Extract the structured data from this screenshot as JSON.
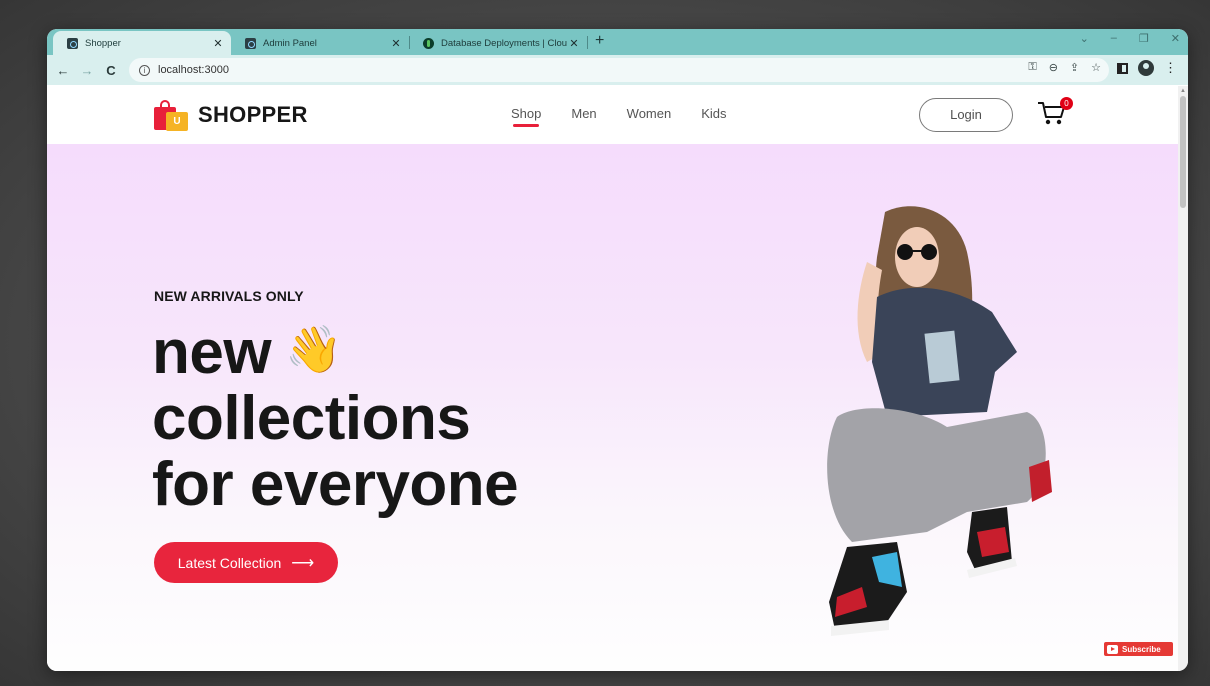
{
  "browser": {
    "tabs": [
      {
        "title": "Shopper",
        "active": true
      },
      {
        "title": "Admin Panel",
        "active": false
      },
      {
        "title": "Database Deployments | Cloud: M",
        "active": false
      }
    ],
    "new_tab": "+",
    "address": "localhost:3000",
    "nav": {
      "back": "←",
      "forward": "→",
      "reload": "C"
    },
    "window_controls": {
      "minimize": "–",
      "maximize": "❐",
      "close": "✕",
      "tabs_dropdown": "⌄"
    }
  },
  "site": {
    "brand": "SHOPPER",
    "logo_letter": "U",
    "menu": [
      {
        "label": "Shop",
        "active": true
      },
      {
        "label": "Men",
        "active": false
      },
      {
        "label": "Women",
        "active": false
      },
      {
        "label": "Kids",
        "active": false
      }
    ],
    "login_label": "Login",
    "cart_count": "0"
  },
  "hero": {
    "eyebrow": "NEW ARRIVALS ONLY",
    "line1": "new",
    "wave_emoji": "👋",
    "line2": "collections",
    "line3": "for everyone",
    "cta_label": "Latest Collection",
    "cta_arrow": "⟶"
  },
  "overlay": {
    "subscribe_label": "Subscribe"
  },
  "colors": {
    "accent": "#e8253d",
    "tab_strip": "#79c5c3",
    "hero_top": "#f5dcfc"
  }
}
